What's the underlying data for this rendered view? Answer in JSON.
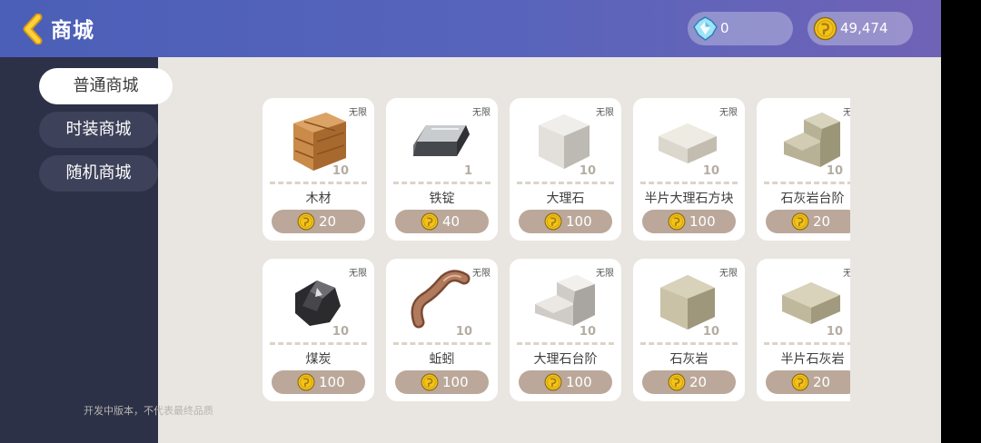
{
  "header": {
    "title": "商城",
    "gems": "0",
    "coins": "49,474"
  },
  "sidebar": {
    "tabs": [
      {
        "label": "普通商城",
        "active": true
      },
      {
        "label": "时装商城",
        "active": false
      },
      {
        "label": "随机商城",
        "active": false
      }
    ]
  },
  "footer_note": "开发中版本，不代表最终品质",
  "items": [
    {
      "name": "木材",
      "qty": "10",
      "stock": "无限",
      "price": "20",
      "icon": "wood-block-icon"
    },
    {
      "name": "铁锭",
      "qty": "1",
      "stock": "无限",
      "price": "40",
      "icon": "iron-ingot-icon"
    },
    {
      "name": "大理石",
      "qty": "10",
      "stock": "无限",
      "price": "100",
      "icon": "marble-block-icon"
    },
    {
      "name": "半片大理石方块",
      "qty": "10",
      "stock": "无限",
      "price": "100",
      "icon": "marble-slab-icon"
    },
    {
      "name": "石灰岩台阶",
      "qty": "10",
      "stock": "无限",
      "price": "20",
      "icon": "limestone-stairs-icon"
    },
    {
      "name": "煤炭",
      "qty": "10",
      "stock": "无限",
      "price": "100",
      "icon": "coal-icon"
    },
    {
      "name": "蚯蚓",
      "qty": "10",
      "stock": "无限",
      "price": "100",
      "icon": "earthworm-icon"
    },
    {
      "name": "大理石台阶",
      "qty": "10",
      "stock": "无限",
      "price": "100",
      "icon": "marble-stairs-icon"
    },
    {
      "name": "石灰岩",
      "qty": "10",
      "stock": "无限",
      "price": "20",
      "icon": "limestone-block-icon"
    },
    {
      "name": "半片石灰岩",
      "qty": "10",
      "stock": "无限",
      "price": "20",
      "icon": "limestone-slab-icon"
    }
  ],
  "colors": {
    "header_start": "#4b5fb8",
    "header_end": "#6f63b6",
    "sidebar": "#2c3148",
    "price_pill": "#bba89a",
    "coin": "#f2c41a"
  }
}
